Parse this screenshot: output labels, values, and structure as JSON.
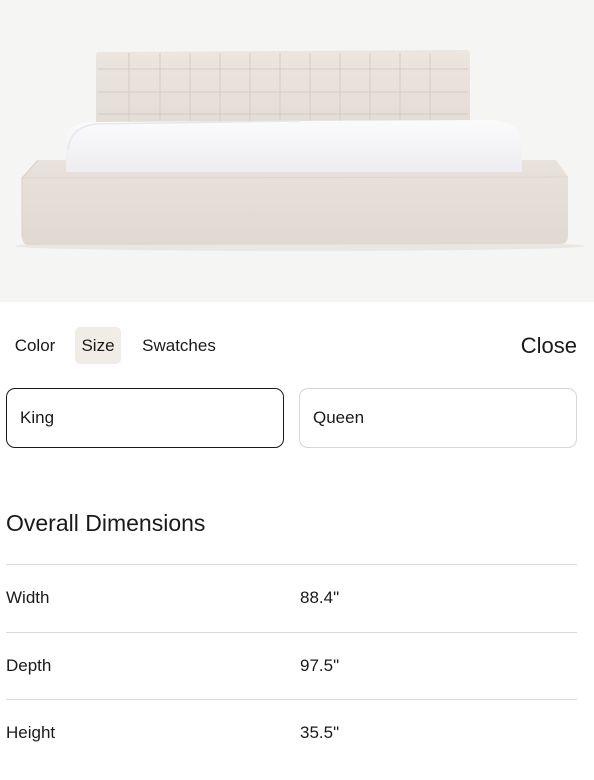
{
  "tabs": {
    "color_label": "Color",
    "size_label": "Size",
    "swatches_label": "Swatches",
    "active": "Size"
  },
  "close_label": "Close",
  "sizes": {
    "options": [
      {
        "label": "King",
        "selected": true
      },
      {
        "label": "Queen",
        "selected": false
      }
    ]
  },
  "dimensions": {
    "title": "Overall Dimensions",
    "rows": [
      {
        "label": "Width",
        "value": "88.4\""
      },
      {
        "label": "Depth",
        "value": "97.5\""
      },
      {
        "label": "Height",
        "value": "35.5\""
      }
    ]
  },
  "colors": {
    "active_tab_bg": "#f0ede7",
    "upholstery": "#e9e3dc",
    "mattress": "#f7f7f9",
    "hero_bg": "#f5f5f3"
  }
}
